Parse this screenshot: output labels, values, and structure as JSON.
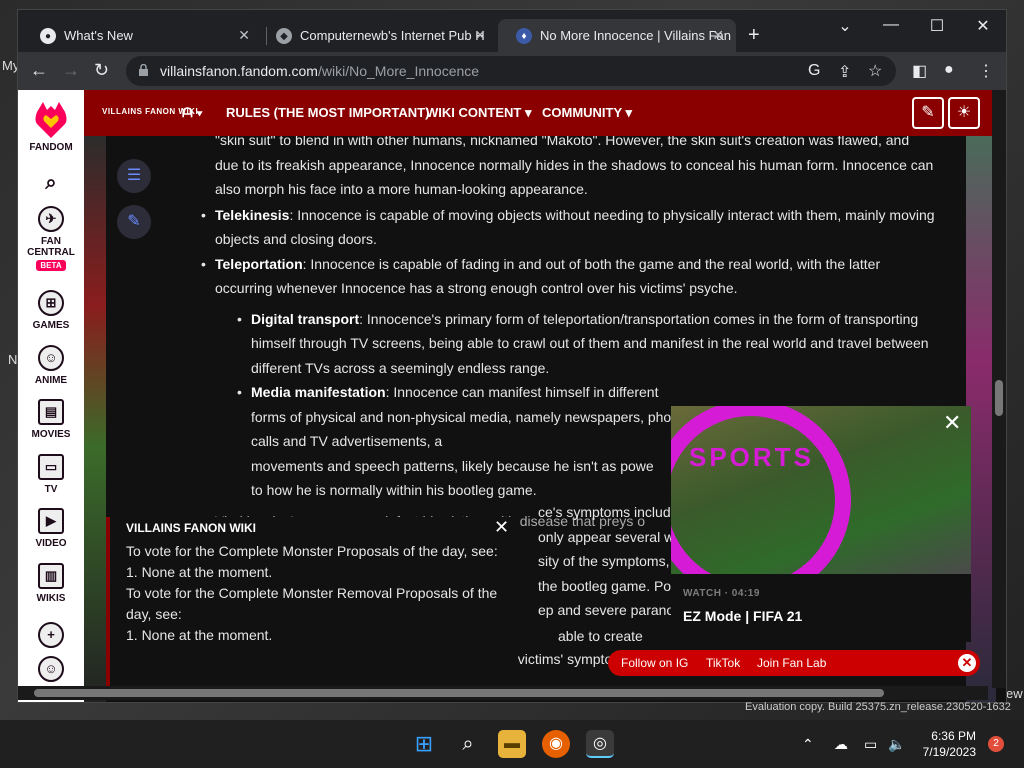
{
  "desktop": {
    "left_label_1": "My",
    "left_label_2": "N",
    "right_label": "ew"
  },
  "browser": {
    "tabs": [
      {
        "title": "What's New"
      },
      {
        "title": "Computernewb's Internet Pub H"
      },
      {
        "title": "No More Innocence | Villains Fan"
      }
    ],
    "url_domain": "villainsfanon.fandom.com",
    "url_path": "/wiki/No_More_Innocence"
  },
  "fandom_rail": {
    "brand": "FANDOM",
    "items": [
      "FAN CENTRAL",
      "GAMES",
      "ANIME",
      "MOVIES",
      "TV",
      "VIDEO",
      "WIKIS"
    ],
    "beta_badge": "BETA"
  },
  "wiki_header": {
    "logo_text": "VILLAINS FANON WIKI",
    "nav": [
      "RULES (THE MOST IMPORTANT)",
      "WIKI CONTENT",
      "COMMUNITY"
    ]
  },
  "article": {
    "intro": "\"skin suit\" to blend in with other humans, nicknamed \"Makoto\". However, the skin suit's creation was flawed, and due to its freakish appearance, Innocence normally hides in the shadows to conceal his human form. Innocence can also morph his face into a more human-looking appearance.",
    "telekinesis_title": "Telekinesis",
    "telekinesis_text": ": Innocence is capable of moving objects without needing to physically interact with them, mainly moving objects and closing doors.",
    "teleportation_title": "Teleportation",
    "teleportation_text": ": Innocence is capable of fading in and out of both the game and the real world, with the latter occurring whenever Innocence has a strong enough control over his victims' psyche.",
    "digital_title": "Digital transport",
    "digital_text": ": Innocence's primary form of teleportation/transportation comes in the form of transporting himself through TV screens, being able to crawl out of them and manifest in the real world and travel between different TVs across a seemingly endless range.",
    "media_title": "Media manifestation",
    "media_text": ": Innocence can manifest himself in different forms of physical and non-physical media, namely newspapers, phone calls and TV advertisements, a",
    "media_text_2": "movements and speech patterns, likely because he isn't as powe",
    "media_text_3": "to how he is normally within his bootleg game.",
    "virulent_partial": "Virokinesis: Innocence can infect his victims with disease that preys o",
    "frag_1": "ce's symptoms include",
    "frag_2": "only appear several wee",
    "frag_3": "sity of the symptoms, th",
    "frag_4": "the bootleg game. Polic",
    "frag_5": "ep and severe paranoia",
    "frag_6": "able to create",
    "frag_7": "enhance their effectiveness, making his victims' symptoms more severe and leading to their mental"
  },
  "notice": {
    "title": "VILLAINS FANON WIKI",
    "lines": [
      "To vote for the Complete Monster Proposals of the day, see:",
      "1. None at the moment.",
      "To vote for the Complete Monster Removal Proposals of the day, see:",
      "1. None at the moment."
    ]
  },
  "video": {
    "brand": "SPORTS",
    "meta": "WATCH · 04:19",
    "title": "EZ Mode | FIFA 21"
  },
  "social": {
    "ig": "Follow on IG",
    "tiktok": "TikTok",
    "fanlab": "Join Fan Lab"
  },
  "watermark": "Evaluation copy. Build 25375.zn_release.230520-1632",
  "taskbar": {
    "time": "6:36 PM",
    "date": "7/19/2023",
    "notifications": "2"
  }
}
